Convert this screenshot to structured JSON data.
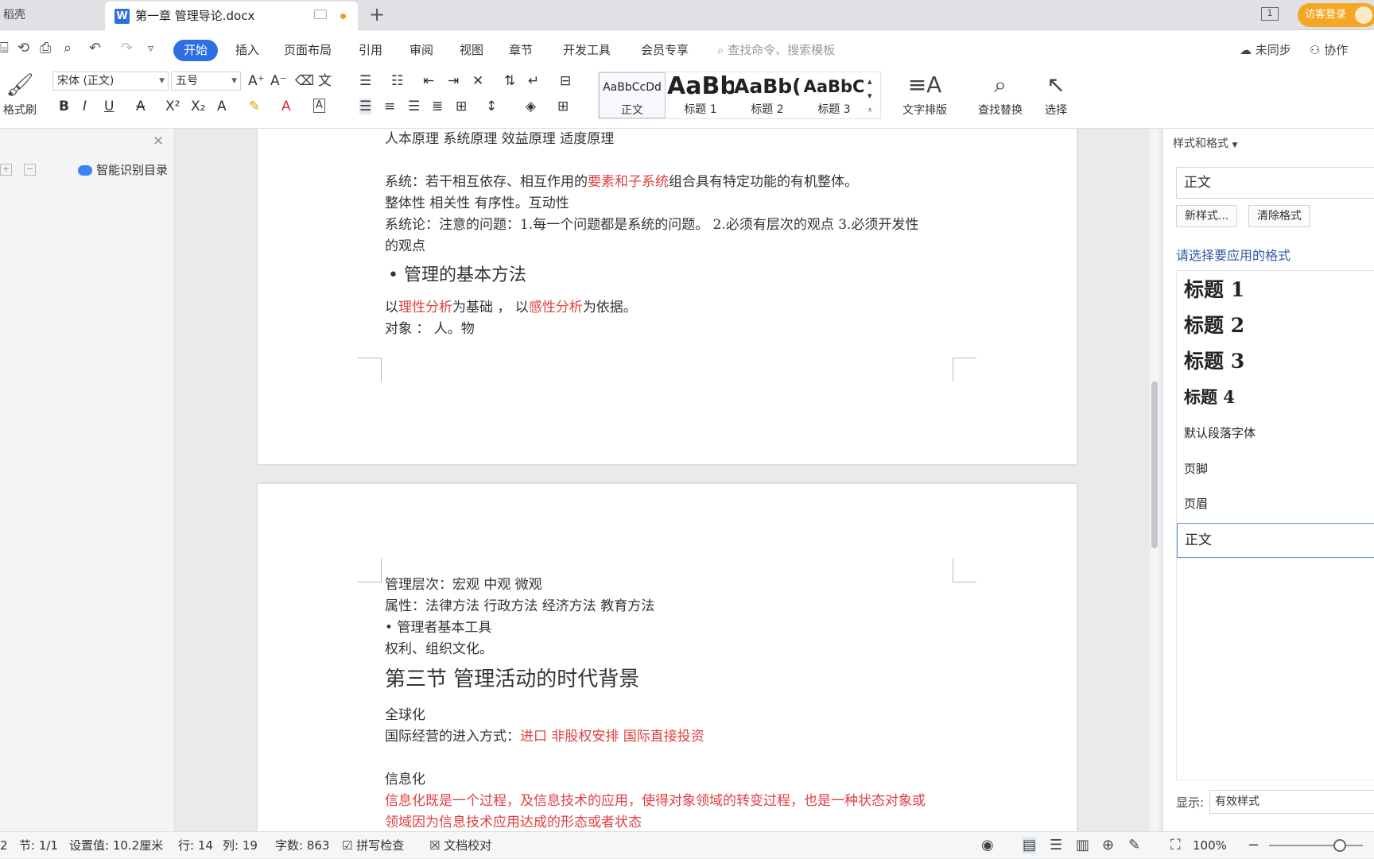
{
  "tabbar": {
    "home": "稻壳",
    "doc_icon": "W",
    "doc_title": "第一章 管理导论.docx",
    "new_tab": "+",
    "window_count": "1",
    "guest_login": "访客登录"
  },
  "menu": {
    "items": [
      "开始",
      "插入",
      "页面布局",
      "引用",
      "审阅",
      "视图",
      "章节",
      "开发工具",
      "会员专享"
    ],
    "search": "查找命令、搜索模板",
    "sync": "未同步",
    "collab": "协作"
  },
  "ribbon": {
    "format_painter": "格式刷",
    "font_name": "宋体 (正文)",
    "font_size": "五号",
    "styles": [
      {
        "preview": "AaBbCcDd",
        "label": "正文"
      },
      {
        "preview": "AaBb",
        "label": "标题 1"
      },
      {
        "preview": "AaBb(",
        "label": "标题 2"
      },
      {
        "preview": "AaBbC",
        "label": "标题 3"
      }
    ],
    "text_layout": "文字排版",
    "find_replace": "查找替换",
    "select": "选择"
  },
  "navpanel": {
    "toc_label": "智能识别目录"
  },
  "document": {
    "p1": {
      "l1": "人本原理 系统原理 效益原理 适度原理",
      "l2a": "系统：若干相互依存、相互作用的",
      "l2b": "要素和子系统",
      "l2c": "组合具有特定功能的有机整体。",
      "l3": "整体性 相关性 有序性。互动性",
      "l4": "系统论：注意的问题：1.每一个问题都是系统的问题。 2.必须有层次的观点 3.必须开发性",
      "l5": "的观点",
      "h": "• 管理的基本方法",
      "l6a": "以",
      "l6b": "理性分析",
      "l6c": "为基础 ， 以",
      "l6d": "感性分析",
      "l6e": "为依据。",
      "l7": "对象 ： 人。物"
    },
    "p2": {
      "l1": "管理层次：宏观 中观 微观",
      "l2": "属性：法律方法 行政方法 经济方法 教育方法",
      "l3": "• 管理者基本工具",
      "l4": "权利、组织文化。",
      "h": "第三节 管理活动的时代背景",
      "l5": "全球化",
      "l6a": "国际经营的进入方式：",
      "l6b": "进口 非股权安排 国际直接投资",
      "l7": "信息化",
      "l8": "信息化既是一个过程，及信息技术的应用，使得对象领域的转变过程，也是一种状态对象或",
      "l9": "领域因为信息技术应用达成的形态或者状态"
    }
  },
  "stylepanel": {
    "title": "样式和格式",
    "current": "正文",
    "new_style": "新样式...",
    "clear_format": "清除格式",
    "hint": "请选择要应用的格式",
    "items": [
      "标题 1",
      "标题 2",
      "标题 3",
      "标题 4",
      "默认段落字体",
      "页脚",
      "页眉",
      "正文"
    ],
    "show_label": "显示:",
    "show_value": "有效样式"
  },
  "status": {
    "page": "2",
    "section": "节: 1/1",
    "setting": "设置值: 10.2厘米",
    "line": "行: 14",
    "col": "列: 19",
    "words": "字数: 863",
    "spell": "拼写检查",
    "doc_check": "文档校对",
    "zoom": "100%"
  },
  "colors": {
    "accent": "#2f6fe4",
    "doc_red": "#e04040",
    "guest": "#f5a623"
  }
}
